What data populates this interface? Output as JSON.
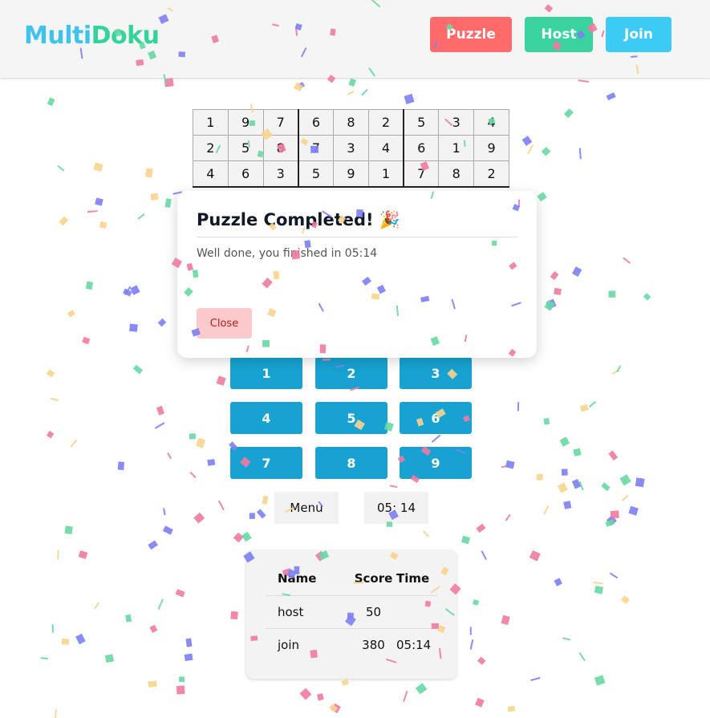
{
  "header": {
    "logo_part1": "Multi",
    "logo_part2": "Doku",
    "nav": [
      {
        "label": "Puzzle",
        "color": "#ff6b6b"
      },
      {
        "label": "Host",
        "color": "#38d39f"
      },
      {
        "label": "Join",
        "color": "#3ccbf4"
      }
    ]
  },
  "board": {
    "rows": [
      [
        "1",
        "9",
        "7",
        "6",
        "8",
        "2",
        "5",
        "3",
        "4"
      ],
      [
        "2",
        "5",
        "8",
        "7",
        "3",
        "4",
        "6",
        "1",
        "9"
      ],
      [
        "4",
        "6",
        "3",
        "5",
        "9",
        "1",
        "7",
        "8",
        "2"
      ]
    ]
  },
  "dialog": {
    "title": "Puzzle Completed! 🎉",
    "message": "Well done, you finished in 05:14",
    "close_label": "Close"
  },
  "numpad": [
    "1",
    "2",
    "3",
    "4",
    "5",
    "6",
    "7",
    "8",
    "9"
  ],
  "controls": {
    "menu_label": "Menu",
    "timer": "05: 14"
  },
  "scoreboard": {
    "headers": [
      "Name",
      "Score",
      "Time"
    ],
    "rows": [
      [
        "host",
        "50",
        ""
      ],
      [
        "join",
        "380",
        "05:14"
      ]
    ]
  },
  "confetti_colors": [
    "#f07aa0",
    "#fbd38d",
    "#68d8a3",
    "#7c7ff5"
  ]
}
